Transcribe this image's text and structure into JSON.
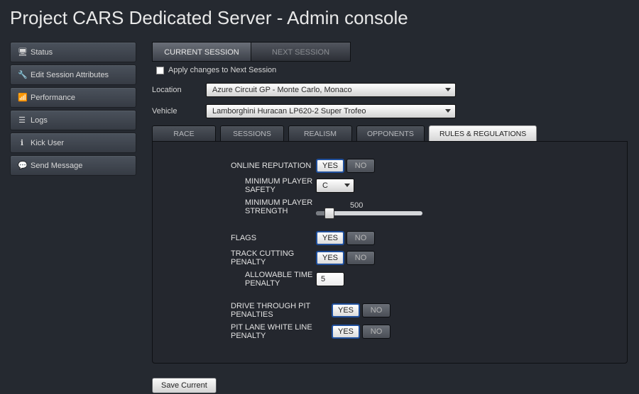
{
  "page_title": "Project CARS Dedicated Server - Admin console",
  "sidebar": {
    "items": [
      {
        "icon": "monitor",
        "label": "Status"
      },
      {
        "icon": "wrench",
        "label": "Edit Session Attributes"
      },
      {
        "icon": "bars",
        "label": "Performance"
      },
      {
        "icon": "list",
        "label": "Logs"
      },
      {
        "icon": "info",
        "label": "Kick User"
      },
      {
        "icon": "chat",
        "label": "Send Message"
      }
    ]
  },
  "session_tabs": {
    "current": "CURRENT SESSION",
    "next": "NEXT SESSION",
    "active": "current"
  },
  "apply_next": {
    "label": "Apply changes to Next Session",
    "checked": false
  },
  "selectors": {
    "location_label": "Location",
    "location_value": "Azure Circuit GP - Monte Carlo, Monaco",
    "vehicle_label": "Vehicle",
    "vehicle_value": "Lamborghini Huracan LP620-2 Super Trofeo"
  },
  "inner_tabs": {
    "items": [
      "RACE",
      "SESSIONS",
      "REALISM",
      "OPPONENTS",
      "RULES & REGULATIONS"
    ],
    "active_index": 4
  },
  "rules": {
    "online_reputation": {
      "label": "ONLINE REPUTATION",
      "value": "YES"
    },
    "min_player_safety": {
      "label": "MINIMUM PLAYER SAFETY",
      "value": "C"
    },
    "min_player_strength": {
      "label": "MINIMUM PLAYER STRENGTH",
      "value": 500,
      "min": 0,
      "max": 5000
    },
    "flags": {
      "label": "FLAGS",
      "value": "YES"
    },
    "track_cutting_penalty": {
      "label": "TRACK CUTTING PENALTY",
      "value": "YES"
    },
    "allowable_time_penalty": {
      "label": "ALLOWABLE TIME PENALTY",
      "value": 5
    },
    "drive_through_pit": {
      "label": "DRIVE THROUGH PIT PENALTIES",
      "value": "YES"
    },
    "pit_white_line": {
      "label": "PIT LANE WHITE LINE PENALTY",
      "value": "YES"
    },
    "yn_options": {
      "yes": "YES",
      "no": "NO"
    }
  },
  "save_button": "Save Current"
}
